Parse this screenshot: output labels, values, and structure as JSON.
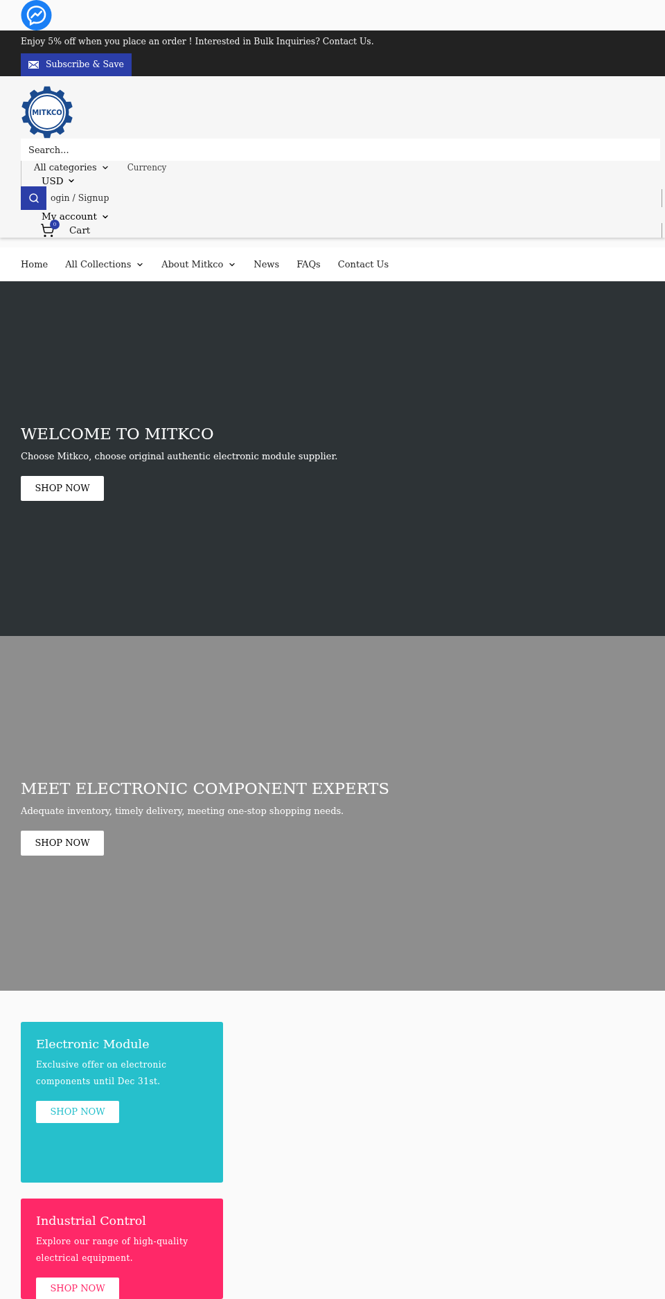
{
  "announcement": {
    "text": "Enjoy 5% off when you place an order ! Interested in Bulk Inquiries? Contact Us.",
    "button": "Subscribe & Save"
  },
  "header": {
    "logo": "MITKCO",
    "search": {
      "placeholder": "Search...",
      "category": "All categories"
    },
    "currency": {
      "label": "Currency",
      "value": "USD"
    },
    "login": "ogin / Signup",
    "account": "My account",
    "cart": {
      "label": "Cart",
      "count": "0"
    }
  },
  "nav": [
    {
      "label": "Home",
      "dropdown": false
    },
    {
      "label": "All Collections",
      "dropdown": true
    },
    {
      "label": "About Mitkco",
      "dropdown": true
    },
    {
      "label": "News",
      "dropdown": false
    },
    {
      "label": "FAQs",
      "dropdown": false
    },
    {
      "label": "Contact Us",
      "dropdown": false
    }
  ],
  "hero_slides": [
    {
      "title": "WELCOME TO MITKCO",
      "subtitle": "Choose Mitkco, choose original authentic electronic module supplier.",
      "button": "SHOP NOW",
      "color": "#2d3336"
    },
    {
      "title": "MEET ELECTRONIC COMPONENT EXPERTS",
      "subtitle": "Adequate inventory, timely delivery, meeting one-stop shopping needs.",
      "button": "SHOP NOW",
      "color": "#8e8e8e"
    }
  ],
  "promo_cards": [
    {
      "title": "Electronic Module",
      "text": "Exclusive offer on electronic components until Dec 31st.",
      "button": "SHOP NOW",
      "color": "#26c0cc"
    },
    {
      "title": "Industrial Control",
      "text": "Explore our range of high-quality electrical equipment.",
      "button": "SHOP NOW",
      "color": "#ff2868"
    }
  ]
}
